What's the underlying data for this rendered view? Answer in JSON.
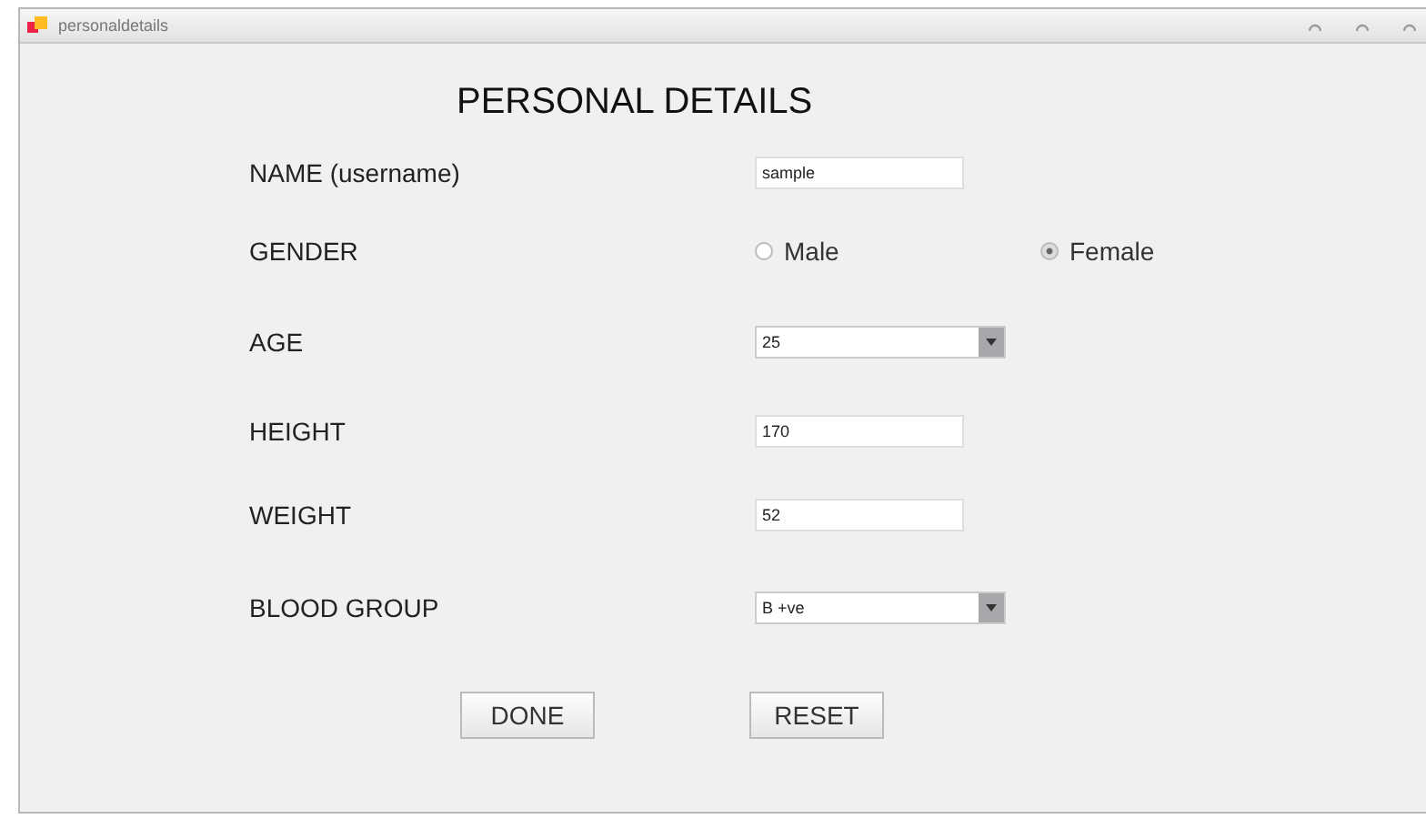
{
  "window": {
    "title": "personaldetails"
  },
  "heading": "PERSONAL DETAILS",
  "fields": [
    {
      "kind": "text",
      "label": "NAME (username)",
      "value": "sample"
    },
    {
      "kind": "radio",
      "label": "GENDER",
      "options": [
        {
          "label": "Male",
          "selected": false
        },
        {
          "label": "Female",
          "selected": true
        }
      ]
    },
    {
      "kind": "select",
      "label": "AGE",
      "value": "25"
    },
    {
      "kind": "text",
      "label": "HEIGHT",
      "value": "170"
    },
    {
      "kind": "text",
      "label": "WEIGHT",
      "value": "52"
    },
    {
      "kind": "select",
      "label": "BLOOD GROUP",
      "value": "B +ve"
    }
  ],
  "buttons": [
    "DONE",
    "RESET"
  ]
}
